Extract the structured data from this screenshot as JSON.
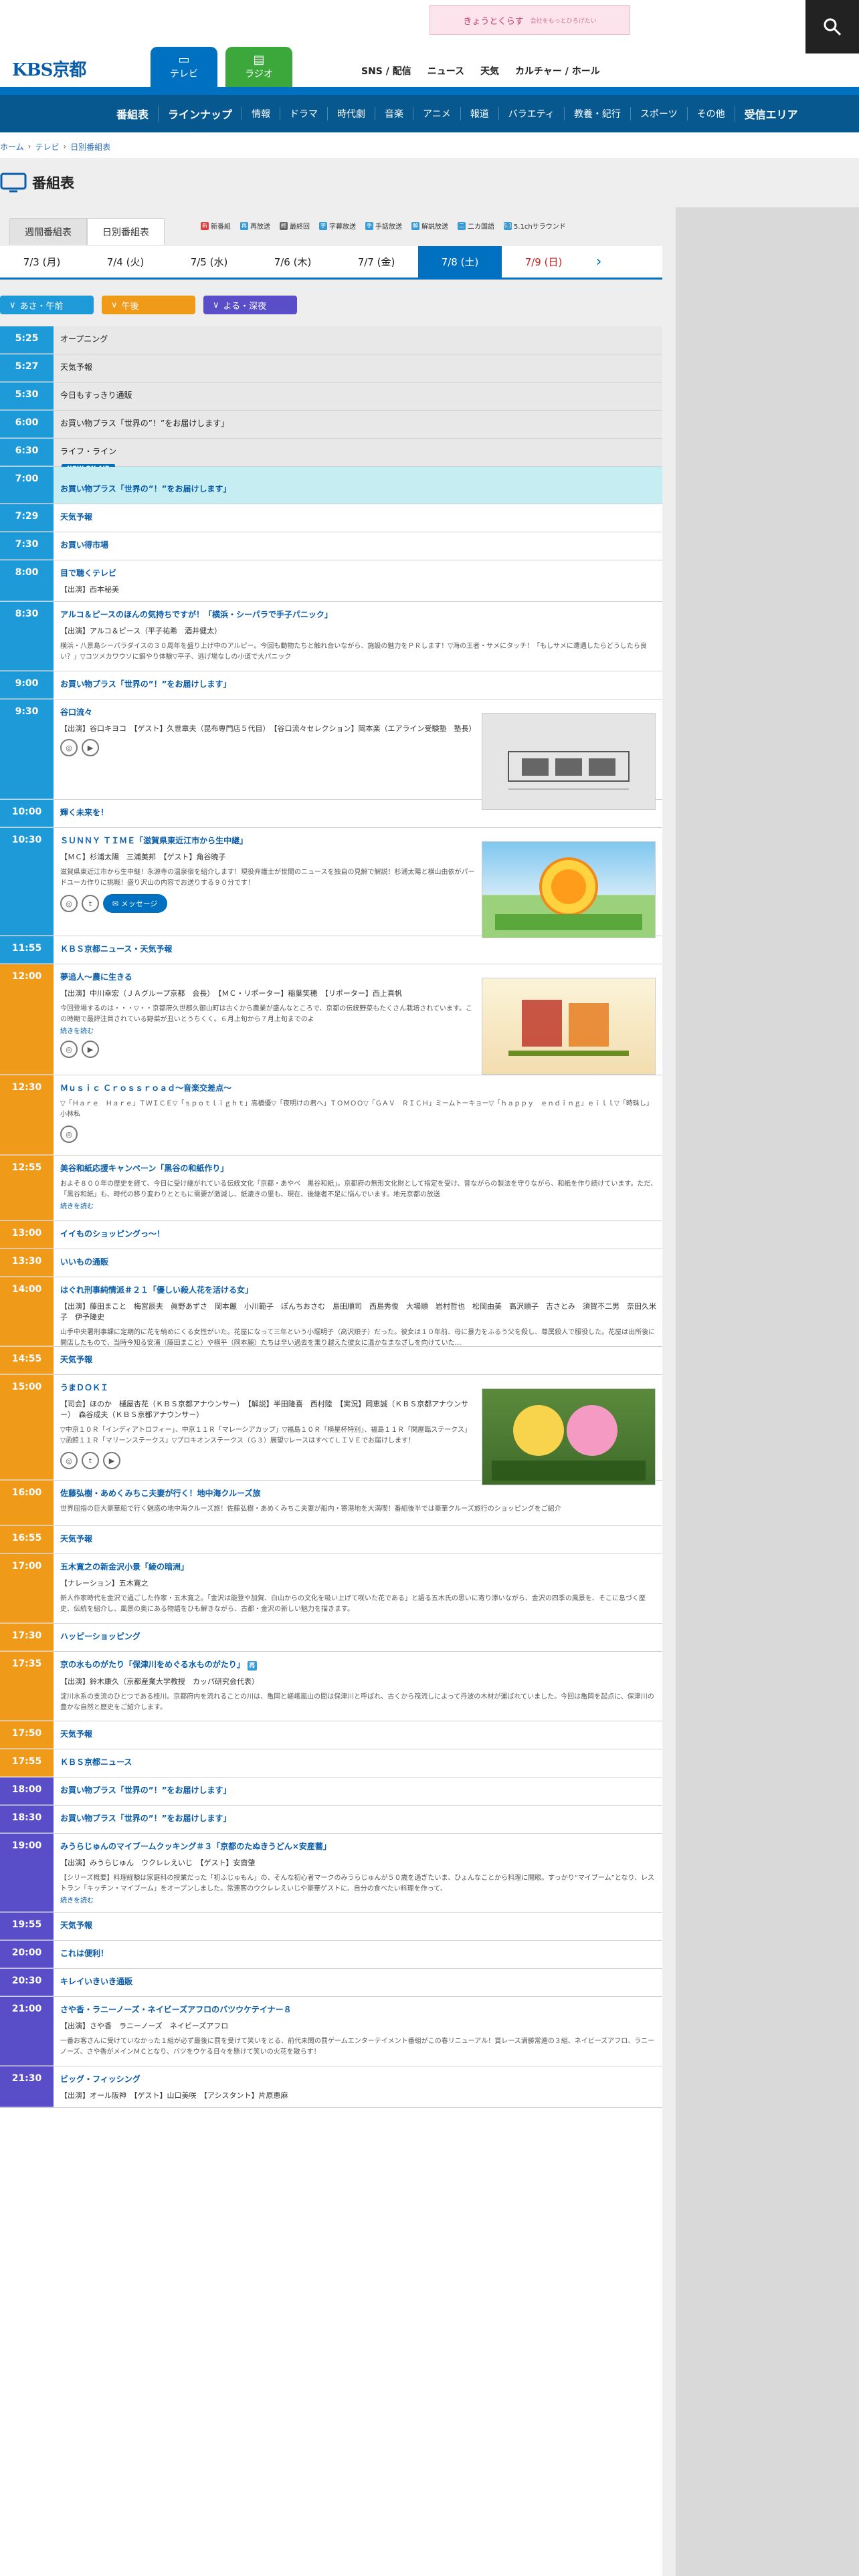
{
  "banner": {
    "text": "きょうとくらす",
    "sub": "会社をもっとひろげたい"
  },
  "tabs": {
    "tv": "テレビ",
    "radio": "ラジオ"
  },
  "logo": "KBS京都",
  "global_nav": [
    "SNS / 配信",
    "ニュース",
    "天気",
    "カルチャー / ホール"
  ],
  "category_nav": [
    "番組表",
    "ラインナップ",
    "情報",
    "ドラマ",
    "時代劇",
    "音楽",
    "アニメ",
    "報道",
    "バラエティ",
    "教養・紀行",
    "スポーツ",
    "その他",
    "受信エリア"
  ],
  "breadcrumb": [
    "ホーム",
    "テレビ",
    "日別番組表"
  ],
  "page_title": "番組表",
  "mode_tabs": [
    "週間番組表",
    "日別番組表"
  ],
  "legend": [
    {
      "mark": "新",
      "label": "新番組",
      "color": "#e0393e"
    },
    {
      "mark": "再",
      "label": "再放送",
      "color": "#3a9bd4"
    },
    {
      "mark": "終",
      "label": "最終回",
      "color": "#666666"
    },
    {
      "mark": "字",
      "label": "字幕放送",
      "color": "#3a9bd4"
    },
    {
      "mark": "手",
      "label": "手話放送",
      "color": "#3a9bd4"
    },
    {
      "mark": "解",
      "label": "解説放送",
      "color": "#3a9bd4"
    },
    {
      "mark": "二",
      "label": "二カ国語",
      "color": "#3a9bd4"
    },
    {
      "mark": "5.1",
      "label": "5.1chサラウンド",
      "color": "#3a9bd4"
    }
  ],
  "dates": [
    {
      "label": "7/3 (月)",
      "kind": "normal"
    },
    {
      "label": "7/4 (火)",
      "kind": "normal"
    },
    {
      "label": "7/5 (水)",
      "kind": "normal"
    },
    {
      "label": "7/6 (木)",
      "kind": "normal"
    },
    {
      "label": "7/7 (金)",
      "kind": "normal"
    },
    {
      "label": "7/8 (土)",
      "kind": "active"
    },
    {
      "label": "7/9 (日)",
      "kind": "sun"
    }
  ],
  "slot_buttons": [
    {
      "label": "あさ・午前",
      "color": "#1f9ad8"
    },
    {
      "label": "午後",
      "color": "#f09a1a"
    },
    {
      "label": "よる・深夜",
      "color": "#5a4ec8"
    }
  ],
  "now_badge": "NOW ON AIR",
  "message_button": "メッセージ",
  "programs": [
    {
      "time": "5:25",
      "title": "オープニング",
      "state": "past",
      "band": "am"
    },
    {
      "time": "5:27",
      "title": "天気予報",
      "state": "past",
      "band": "am"
    },
    {
      "time": "5:30",
      "title": "今日もすっきり通販",
      "state": "past",
      "band": "am"
    },
    {
      "time": "6:00",
      "title": "お買い物プラス「世界の”！”をお届けします」",
      "state": "past",
      "band": "am"
    },
    {
      "time": "6:30",
      "title": "ライフ・ライン",
      "state": "past",
      "band": "am"
    },
    {
      "time": "7:00",
      "title": "お買い物プラス「世界の”！”をお届けします」",
      "state": "now",
      "band": "am"
    },
    {
      "time": "7:29",
      "title": "天気予報",
      "band": "am"
    },
    {
      "time": "7:30",
      "title": "お買い得市場",
      "band": "am"
    },
    {
      "time": "8:00",
      "title": "目で聴くテレビ",
      "cast": "【出演】西本秘美",
      "band": "am"
    },
    {
      "time": "8:30",
      "title": "アルコ＆ピースのほんの気持ちですが！「横浜・シーパラで手子パニック」",
      "cast": "【出演】アルコ＆ピース（平子祐希　酒井健太）",
      "desc": "横浜・八景島シーパラダイスの３０周年を盛り上げ中のアルピー。今回も動物たちと触れ合いながら、施設の魅力をＰＲします！▽海の王者・サメにタッチ！「もしサメに遭遇したらどうしたら良い？」▽コツメカワウソに餌やり体験▽平子、逃げ場なしの小道で大パニック",
      "band": "am",
      "fulldesc": true
    },
    {
      "time": "9:00",
      "title": "お買い物プラス「世界の”！”をお届けします」",
      "band": "am"
    },
    {
      "time": "9:30",
      "title": "谷口流々",
      "cast": "【出演】谷口キヨコ　【ゲスト】久世章夫（昆布専門店５代目）　【谷口流々セレクション】岡本楽（エアライン受験塾　塾長）",
      "icons": [
        "web",
        "yt"
      ],
      "thumb": "taniguchi",
      "band": "am"
    },
    {
      "time": "10:00",
      "title": "輝く未来を！",
      "band": "am"
    },
    {
      "time": "10:30",
      "title": "ＳＵＮＮＹ ＴＩＭＥ「滋賀県東近江市から生中継」",
      "cast": "【ＭＣ】杉浦太陽　三浦美邦　【ゲスト】角谷暁子",
      "desc": "滋賀県東近江市から生中継！永源寺の温泉宿を紹介します！現役弁護士が世間のニュースを独自の見解で解説！杉浦太陽と横山由依がパードユーカ作りに挑戦！盛り沢山の内容でお送りする９０分です！",
      "icons": [
        "web",
        "tw"
      ],
      "message": true,
      "thumb": "sunny",
      "band": "am"
    },
    {
      "time": "11:55",
      "title": "ＫＢＳ京都ニュース・天気予報",
      "band": "am"
    },
    {
      "time": "12:00",
      "title": "夢追人～農に生きる",
      "cast": "【出演】中川幸宏（ＪＡグループ京都　会長）　【ＭＣ・リポーター】稲葉笑穂　【リポーター】西上真帆",
      "desc": "今回登場するのは・・・▽・・京都府久世郡久御山町は古くから農業が盛んなところで、京都の伝統野菜もたくさん栽培されています。この時期で最評注目されている野菜が丑いとうちくく。６月上旬から７月上旬までのよ",
      "more": "続きを読む",
      "icons": [
        "web",
        "yt"
      ],
      "thumb": "yume",
      "band": "pm"
    },
    {
      "time": "12:30",
      "title": "Ｍｕｓｉｃ Ｃｒｏｓｓｒｏａｄ～音楽交差点～",
      "desc": "▽「Ｈａｒｅ　Ｈａｒｅ」ＴＷＩＣＥ▽「ｓｐｏｔｌｉｇｈｔ」高橋優▽「夜明けの君へ」ＴＯＭＯＯ▽「ＧＡＶ　ＲＩＣＨ」ミームトーキョー▽「ｈａｐｐｙ　ｅｎｄｉｎｇ」ｅｉｌｌ▽「時珠し」小林私",
      "icons": [
        "web"
      ],
      "band": "pm",
      "fulldesc": true
    },
    {
      "time": "12:55",
      "title": "美谷和紙応援キャンペーン「黒谷の和紙作り」",
      "desc": "およそ８００年の歴史を経て、今日に受け継がれている伝統文化「京都・あやべ　黒谷和紙」。京都府の無形文化財として指定を受け、昔ながらの製法を守りながら、和紙を作り続けています。ただ、「黒谷和紙」も、時代の移り変わりとともに需要が激減し、紙漉きの里も、現在、後継者不足に悩んでいます。地元京都の放送",
      "more": "続きを読む",
      "band": "pm",
      "fulldesc": true
    },
    {
      "time": "13:00",
      "title": "イイものショッピングっ～！",
      "band": "pm"
    },
    {
      "time": "13:30",
      "title": "いいもの通販",
      "band": "pm"
    },
    {
      "time": "14:00",
      "title": "はぐれ刑事純情派＃２１「優しい殺人花を活ける女」",
      "cast": "【出演】藤田まこと　梅宮辰夫　眞野あずさ　岡本麗　小川範子　ぽんちおさむ　島田順司　西島秀俊　大場順　岩村哲也　松岡由美　高沢順子　吉さとみ　須賀不二男　奈田久米子　伊予隆史",
      "desc": "山手中央署刑事課に定期的に花を納めにくる女性がいた。花屋になって三年という小堀明子（高沢順子）だった。彼女は１０年前、母に暴力をふるう父を殺し、尊属殺人で服役した。花屋は出所後に開店したもので、当時今知る安浦（藤田まこと）や横平（岡本麗）たちは辛い過去を乗り越えた彼女に温かなまなざしを向けていた…",
      "band": "pm",
      "fulldesc": true
    },
    {
      "time": "14:55",
      "title": "天気予報",
      "band": "pm"
    },
    {
      "time": "15:00",
      "title": "うまＤＯＫＩ",
      "cast": "【司会】ほのか　樋屋杏花（ＫＢＳ京都アナウンサー）　【解説】半田隆喜　西村陸　【実況】岡恵誠（ＫＢＳ京都アナウンサー）　森谷成夫（ＫＢＳ京都アナウンサー）",
      "desc": "▽中京１０Ｒ「インディアトロフィー」、中京１１Ｒ「マレーシアカップ」▽福島１０Ｒ「横星杯特別」、福島１１Ｒ「関屋臨ステークス」▽函館１１Ｒ「マリーンステークス」▽プロキオンステークス（Ｇ３）展望▽レースはすべてＬＩＶＥでお届けします！",
      "icons": [
        "web",
        "tw",
        "yt"
      ],
      "thumb": "uma",
      "band": "pm"
    },
    {
      "time": "16:00",
      "title": "佐藤弘樹・あめくみちこ夫妻が行く！地中海クルーズ旅",
      "desc": "世界屈指の巨大豪華船で行く魅惑の地中海クルーズ旅！佐藤弘樹・あめくみちこ夫妻が船内・寄港地を大満喫！番組後半では豪華クルーズ旅行のショッピングをご紹介",
      "band": "pm",
      "fulldesc": true
    },
    {
      "time": "16:55",
      "title": "天気予報",
      "band": "pm"
    },
    {
      "time": "17:00",
      "title": "五木寛之の新金沢小景「綾の暗洲」",
      "cast": "【ナレーション】五木寛之",
      "desc": "新人作家時代を金沢で過ごした作家・五木寛之。「金沢は能登や加賀、白山からの文化を吸い上げて咲いた花である」と語る五木氏の思いに寄り添いながら、金沢の四季の風景を、そこに息づく歴史、伝統を紹介し、風景の奥にある物語をひも解きながら、古都・金沢の新しい魅力を描きます。",
      "band": "pm",
      "fulldesc": true
    },
    {
      "time": "17:30",
      "title": "ハッピーショッピング",
      "band": "pm"
    },
    {
      "time": "17:35",
      "title": "京の水ものがたり「保津川をめぐる水ものがたり」",
      "rebadge": "再",
      "cast": "【出演】鈴木康久（京都産業大学教授　カッパ研究会代表）",
      "desc": "淀川水系の支流のひとつである桂川。京都府内を流れることの川は、亀岡と嵯峨嵐山の間は保津川と呼ばれ、古くから筏流しによって丹波の木材が運ばれていました。今回は亀岡を起点に、保津川の豊かな自然と歴史をご紹介します。",
      "band": "pm",
      "fulldesc": true
    },
    {
      "time": "17:50",
      "title": "天気予報",
      "band": "pm"
    },
    {
      "time": "17:55",
      "title": "ＫＢＳ京都ニュース",
      "band": "pm"
    },
    {
      "time": "18:00",
      "title": "お買い物プラス「世界の”！”をお届けします」",
      "band": "ev"
    },
    {
      "time": "18:30",
      "title": "お買い物プラス「世界の”！”をお届けします」",
      "band": "ev"
    },
    {
      "time": "19:00",
      "title": "みうらじゅんのマイブームクッキング＃３「京都のたぬきうどん×安産蕎」",
      "cast": "【出演】みうらじゅん　ウクレレえいじ　【ゲスト】安齋肇",
      "desc": "【シリーズ概要】料理経験は家庭科の授業だった「初ふじゅもん」の、そんな初心者マークのみうらじゅんが５０歳を過ぎたいま、ひょんなことから料理に開眼。すっかり“マイブーム”となり、レストラン「キッチン・マイブーム」をオープンしました。常連客のウクレレえいじや豪華ゲストに、自分の食べたい料理を作って、",
      "more": "続きを読む",
      "band": "ev",
      "fulldesc": true
    },
    {
      "time": "19:55",
      "title": "天気予報",
      "band": "ev"
    },
    {
      "time": "20:00",
      "title": "これは便利！",
      "band": "ev"
    },
    {
      "time": "20:30",
      "title": "キレイいきいき通販",
      "band": "ev"
    },
    {
      "time": "21:00",
      "title": "さや香・ラニーノーズ・ネイビーズアフロのバツウケテイナー８",
      "cast": "【出演】さや香　ラニーノーズ　ネイビーズアフロ",
      "desc": "一番お客さんに受けていなかった１組が必ず最後に罰を受けて笑いをとる、前代未聞の罰ゲームエンターテイメント番組がこの春リニューアル！賞レース満勝常連の３組、ネイビーズアフロ、ラニーノーズ、さや香がメインＭＣとなり、バツをウケる日々を懸けて笑いの火花を散らす！",
      "band": "ev",
      "fulldesc": true
    },
    {
      "time": "21:30",
      "title": "ビッグ・フィッシング",
      "cast": "【出演】オール阪神　【ゲスト】山口美咲　【アシスタント】片原恵麻",
      "band": "ev"
    }
  ]
}
